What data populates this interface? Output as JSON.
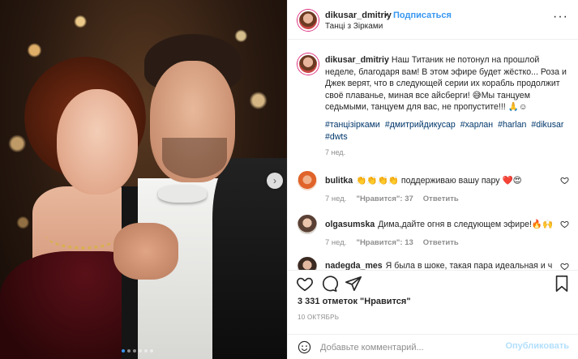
{
  "post": {
    "carousel_dots": 6,
    "carousel_active_index": 0
  },
  "header": {
    "username": "dikusar_dmitriy",
    "separator": "•",
    "follow_label": "Подписаться",
    "location": "Танці з Зірками",
    "more_label": "···"
  },
  "caption": {
    "username": "dikusar_dmitriy",
    "text": "Наш Титаник не потонул на прошлой неделе, благодаря вам! В этом эфире будет жёстко... Роза и Джек верят, что в следующей серии их корабль продолжит своё плаванье, миная все айсберги! 😅Мы танцуем седьмыми, танцуем для вас, не пропустите!!! 🙏☺",
    "hashtags": [
      "#танцізірками",
      "#дмитрийдикусар",
      "#харлан",
      "#harlan",
      "#dikusar",
      "#dwts"
    ],
    "time": "7 нед."
  },
  "comments": [
    {
      "username": "bulitka",
      "text": "👏👏👏👏 поддерживаю вашу пару ❤️😍",
      "time": "7 нед.",
      "likes": "\"Нравится\": 37",
      "reply": "Ответить"
    },
    {
      "username": "olgasumska",
      "text": "Дима,дайте огня в следующем эфире!🔥🙌",
      "time": "7 нед.",
      "likes": "\"Нравится\": 13",
      "reply": "Ответить"
    },
    {
      "username": "nadegda_mes",
      "text": "Я была в шоке, такая пара идеальная и чуть",
      "time": "",
      "likes": "",
      "reply": ""
    }
  ],
  "actions": {
    "likes_text": "3 331 отметок \"Нравится\"",
    "date": "10 ОКТЯБРЬ"
  },
  "add_comment": {
    "placeholder": "Добавьте комментарий...",
    "post_label": "Опубликовать"
  },
  "colors": {
    "link_blue": "#3897f0",
    "hashtag_blue": "#00376b",
    "muted": "#8e8e8e",
    "post_disabled": "#b2dffc"
  }
}
